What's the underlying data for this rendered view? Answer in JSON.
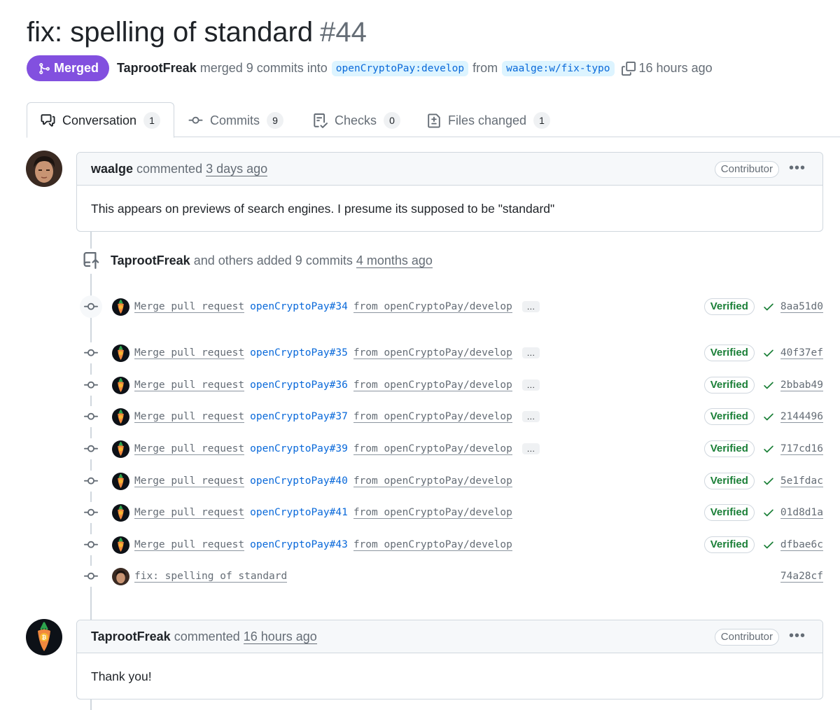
{
  "pr": {
    "title": "fix: spelling of standard",
    "number": "#44",
    "state": "Merged",
    "merged_by": "TaprootFreak",
    "merged_text": "merged 9 commits into",
    "base_branch": "openCryptoPay:develop",
    "from_text": "from",
    "head_branch": "waalge:w/fix-typo",
    "time": "16 hours ago"
  },
  "tabs": [
    {
      "label": "Conversation",
      "count": "1",
      "icon": "comment-discussion-icon"
    },
    {
      "label": "Commits",
      "count": "9",
      "icon": "git-commit-icon"
    },
    {
      "label": "Checks",
      "count": "0",
      "icon": "checklist-icon"
    },
    {
      "label": "Files changed",
      "count": "1",
      "icon": "file-diff-icon"
    }
  ],
  "comments": [
    {
      "author": "waalge",
      "action": "commented",
      "time": "3 days ago",
      "role": "Contributor",
      "body": "This appears on previews of search engines. I presume its supposed to be \"standard\""
    },
    {
      "author": "TaprootFreak",
      "action": "commented",
      "time": "16 hours ago",
      "role": "Contributor",
      "body": "Thank you!"
    }
  ],
  "commits_event": {
    "author": "TaprootFreak",
    "text": "and others added 9 commits",
    "time": "4 months ago"
  },
  "commits": [
    {
      "prefix": "Merge pull request",
      "link": "openCryptoPay#34",
      "suffix": "from openCryptoPay/develop",
      "more": "…",
      "verified": "Verified",
      "sha": "8aa51d0"
    },
    {
      "prefix": "Merge pull request",
      "link": "openCryptoPay#35",
      "suffix": "from openCryptoPay/develop",
      "more": "…",
      "verified": "Verified",
      "sha": "40f37ef"
    },
    {
      "prefix": "Merge pull request",
      "link": "openCryptoPay#36",
      "suffix": "from openCryptoPay/develop",
      "more": "…",
      "verified": "Verified",
      "sha": "2bbab49"
    },
    {
      "prefix": "Merge pull request",
      "link": "openCryptoPay#37",
      "suffix": "from openCryptoPay/develop",
      "more": "…",
      "verified": "Verified",
      "sha": "2144496"
    },
    {
      "prefix": "Merge pull request",
      "link": "openCryptoPay#39",
      "suffix": "from openCryptoPay/develop",
      "more": "…",
      "verified": "Verified",
      "sha": "717cd16"
    },
    {
      "prefix": "Merge pull request",
      "link": "openCryptoPay#40",
      "suffix": "from openCryptoPay/develop",
      "verified": "Verified",
      "sha": "5e1fdac"
    },
    {
      "prefix": "Merge pull request",
      "link": "openCryptoPay#41",
      "suffix": "from openCryptoPay/develop",
      "verified": "Verified",
      "sha": "01d8d1a"
    },
    {
      "prefix": "Merge pull request",
      "link": "openCryptoPay#43",
      "suffix": "from openCryptoPay/develop",
      "verified": "Verified",
      "sha": "dfbae6c"
    },
    {
      "prefix": "fix: spelling of standard",
      "sha": "74a28cf"
    }
  ],
  "colors": {
    "merged": "#8250df",
    "link": "#0969da",
    "verified": "#1a7f37",
    "muted": "#656d76",
    "border": "#d0d7de"
  }
}
